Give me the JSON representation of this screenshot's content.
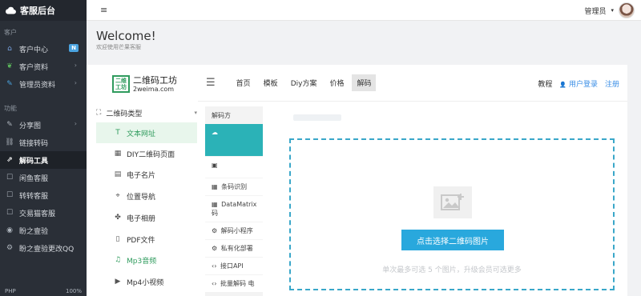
{
  "sidebar": {
    "brand": "客服后台",
    "section_customers": "客户",
    "items_top": [
      {
        "label": "客户中心",
        "icon": "home-icon",
        "badge": "N"
      },
      {
        "label": "客户资料",
        "icon": "leaf-icon",
        "chevron": "›"
      },
      {
        "label": "管理员资料",
        "icon": "pencil-icon",
        "chevron": "›"
      }
    ],
    "section_functions": "功能",
    "items_bottom": [
      {
        "label": "分享图",
        "icon": "pencil-icon",
        "chevron": "›"
      },
      {
        "label": "链接转码",
        "icon": "link-icon"
      },
      {
        "label": "解码工具",
        "icon": "external-link-icon"
      },
      {
        "label": "闲鱼客服",
        "icon": "chat-icon"
      },
      {
        "label": "转转客服",
        "icon": "chat-icon"
      },
      {
        "label": "交易猫客服",
        "icon": "chat-icon"
      },
      {
        "label": "盼之壹验",
        "icon": "user-circle-icon"
      },
      {
        "label": "盼之壹验更改QQ",
        "icon": "gear-icon"
      }
    ],
    "footer_left": "PHP",
    "footer_right": "100%"
  },
  "topbar": {
    "menu_icon": "≡",
    "user_label": "管理员",
    "user_caret": "▾"
  },
  "header": {
    "title": "Welcome!",
    "subtitle": "欢迎使用芒果客服"
  },
  "site": {
    "logo_box": "二维\n工坊",
    "logo_title": "二维码工坊",
    "logo_sub": "2weima.com",
    "nav": [
      "首页",
      "模板",
      "Diy方案",
      "价格",
      "解码"
    ],
    "nav_active": "解码",
    "right_links": {
      "tutorial": "教程",
      "login": "用户登录",
      "register": "注册",
      "login_icon": "👤"
    },
    "category_header": "二维码类型",
    "categories": [
      {
        "label": "文本网址",
        "icon": "T"
      },
      {
        "label": "DIY二维码页面",
        "icon": "▦"
      },
      {
        "label": "电子名片",
        "icon": "▤"
      },
      {
        "label": "位置导航",
        "icon": "⌖"
      },
      {
        "label": "电子相册",
        "icon": "✤"
      },
      {
        "label": "PDF文件",
        "icon": "▯"
      },
      {
        "label": "Mp3音频",
        "icon": "♫"
      },
      {
        "label": "Mp4小视频",
        "icon": "▶"
      }
    ],
    "decoder_header": "解码方",
    "decoders": [
      {
        "label": "",
        "icon": "☁"
      },
      {
        "label": "",
        "icon": "▣"
      },
      {
        "label": "条码识别",
        "icon": "▦"
      },
      {
        "label": "DataMatrix码",
        "icon": "▦"
      },
      {
        "label": "解码小程序",
        "icon": "⚙"
      },
      {
        "label": "私有化部署",
        "icon": "⚙"
      },
      {
        "label": "接口API",
        "icon": "‹›"
      },
      {
        "label": "批量解码 电",
        "icon": "‹›"
      }
    ],
    "upload_button": "点击选择二维码图片",
    "upload_hint": "单次最多可选 5 个图片，升级会员可选更多"
  }
}
